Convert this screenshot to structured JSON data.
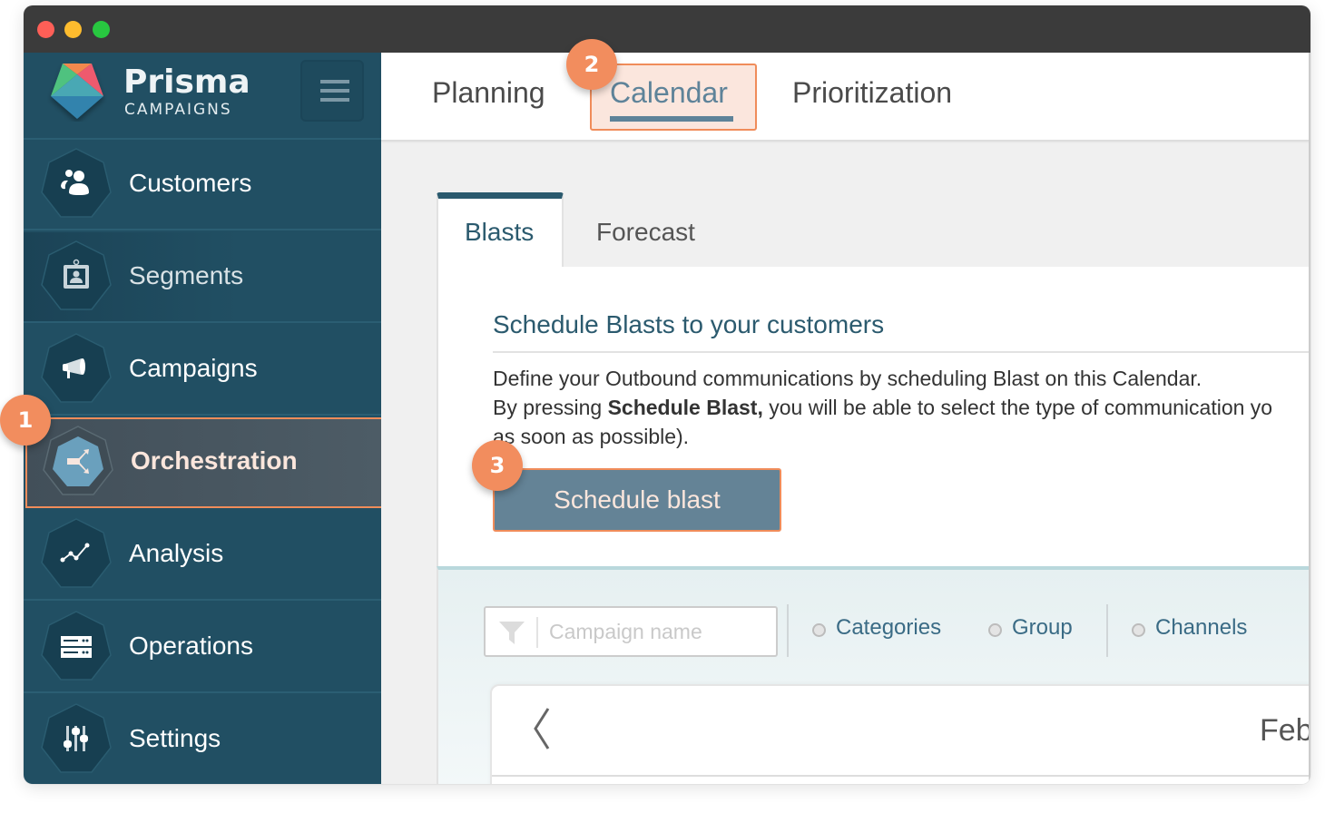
{
  "window": {
    "controls": [
      "close",
      "minimize",
      "maximize"
    ]
  },
  "brand": {
    "name": "Prisma",
    "subtitle": "CAMPAIGNS",
    "menu_icon": "hamburger-icon"
  },
  "sidebar": {
    "items": [
      {
        "label": "Customers",
        "icon": "customers-icon"
      },
      {
        "label": "Segments",
        "icon": "segments-icon"
      },
      {
        "label": "Campaigns",
        "icon": "megaphone-icon"
      },
      {
        "label": "Orchestration",
        "icon": "orchestration-icon",
        "active": true
      },
      {
        "label": "Analysis",
        "icon": "line-chart-icon"
      },
      {
        "label": "Operations",
        "icon": "server-icon"
      },
      {
        "label": "Settings",
        "icon": "sliders-icon"
      }
    ]
  },
  "top_tabs": [
    {
      "label": "Planning"
    },
    {
      "label": "Calendar",
      "active": true
    },
    {
      "label": "Prioritization"
    }
  ],
  "sub_tabs": [
    {
      "label": "Blasts",
      "active": true
    },
    {
      "label": "Forecast"
    }
  ],
  "panel": {
    "title": "Schedule Blasts to your customers",
    "line1": "Define your Outbound communications by scheduling Blast on this Calendar.",
    "line2_prefix": "By pressing ",
    "line2_bold": "Schedule Blast,",
    "line2_suffix": " you will be able to select the type of communication yo",
    "line3": "as soon as possible).",
    "button_label": "Schedule blast"
  },
  "filters": {
    "search_placeholder": "Campaign name",
    "search_value": "",
    "options": [
      {
        "label": "Categories",
        "selected": false
      },
      {
        "label": "Group",
        "selected": false
      },
      {
        "label": "Channels",
        "selected": false
      }
    ]
  },
  "calendar": {
    "month_label": "Feb",
    "prev_icon": "chevron-left-icon"
  },
  "badges": [
    "1",
    "2",
    "3"
  ],
  "colors": {
    "sidebar_bg": "#214f63",
    "accent_orange": "#f28d5e",
    "active_tab": "#5e8399",
    "button_bg": "#648396",
    "title_teal": "#2b5a6e"
  }
}
